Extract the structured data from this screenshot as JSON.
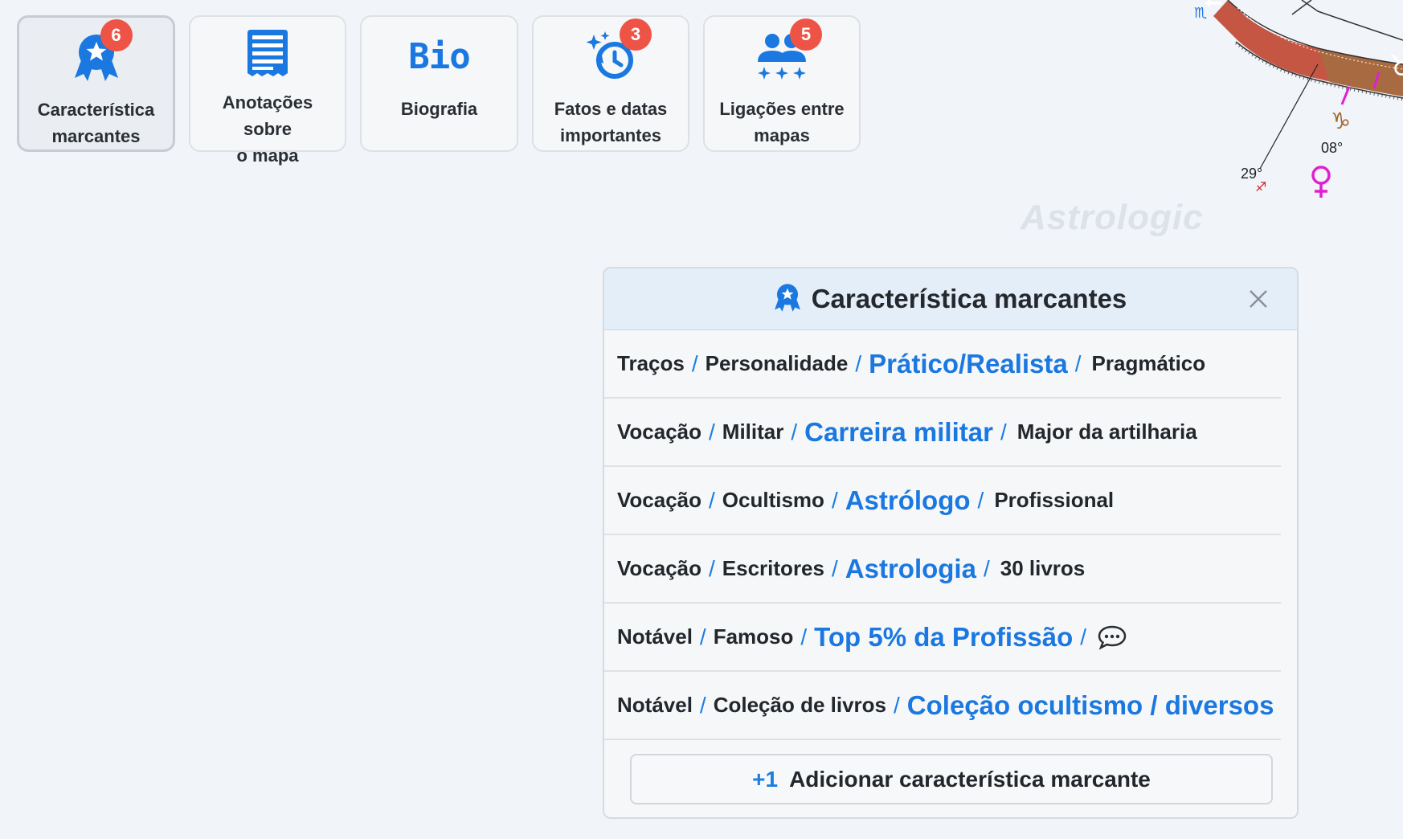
{
  "toolbar": {
    "tiles": [
      {
        "label_line1": "Característica",
        "label_line2": "marcantes",
        "badge": "6",
        "icon": "award-ribbon-icon"
      },
      {
        "label_line1": "Anotações sobre",
        "label_line2": "o mapa",
        "badge": "",
        "icon": "notes-document-icon"
      },
      {
        "label_line1": "Biografia",
        "label_line2": "",
        "icon_text": "Bio",
        "badge": "",
        "icon": "bio-icon"
      },
      {
        "label_line1": "Fatos e datas",
        "label_line2": "importantes",
        "badge": "3",
        "icon": "history-clock-icon"
      },
      {
        "label_line1": "Ligações entre",
        "label_line2": "mapas",
        "badge": "5",
        "icon": "people-link-icon"
      }
    ]
  },
  "watermark": "Astrologic",
  "chart_fragment": {
    "labels": [
      "08°",
      "29°"
    ]
  },
  "panel": {
    "title": "Característica marcantes",
    "rows": [
      {
        "cat1": "Traços",
        "cat2": "Personalidade",
        "main": "Prático/Realista",
        "detail": "Pragmático"
      },
      {
        "cat1": "Vocação",
        "cat2": "Militar",
        "main": "Carreira militar",
        "detail": "Major da artilharia"
      },
      {
        "cat1": "Vocação",
        "cat2": "Ocultismo",
        "main": "Astrólogo",
        "detail": "Profissional"
      },
      {
        "cat1": "Vocação",
        "cat2": "Escritores",
        "main": "Astrologia",
        "detail": "30 livros"
      },
      {
        "cat1": "Notável",
        "cat2": "Famoso",
        "main": "Top 5% da Profissão",
        "detail": ""
      },
      {
        "cat1": "Notável",
        "cat2": "Coleção de livros",
        "main": "Coleção ocultismo / diversos",
        "detail": ""
      }
    ],
    "add_button": {
      "prefix": "+1",
      "label": "Adicionar característica marcante"
    }
  },
  "colors": {
    "accent": "#1a78e0",
    "badge": "#ee5446",
    "venus": "#e020d0"
  }
}
